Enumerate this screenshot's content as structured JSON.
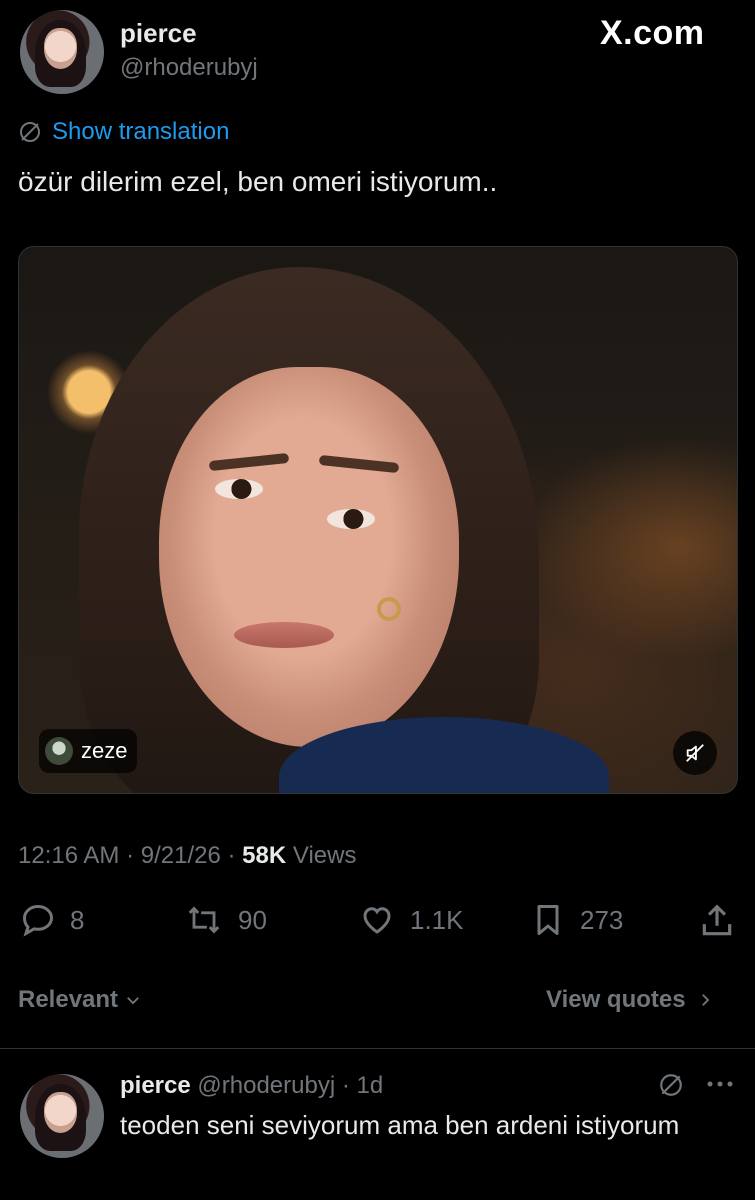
{
  "tweet": {
    "author": {
      "display_name": "pierce",
      "handle": "@rhoderubyj"
    },
    "site_logo": "X.com",
    "translate_label": "Show translation",
    "text": "özür dilerim ezel, ben omeri istiyorum..",
    "media": {
      "source_label": "zeze",
      "mute_icon": "speaker-muted-icon"
    },
    "meta": {
      "time": "12:16 AM",
      "date": "9/21/26",
      "views_count": "58K",
      "views_label": "Views",
      "separator": "·"
    },
    "actions": {
      "replies": "8",
      "reposts": "90",
      "likes": "1.1K",
      "bookmarks": "273"
    }
  },
  "filters": {
    "sort_label": "Relevant",
    "view_quotes_label": "View quotes"
  },
  "reply": {
    "display_name": "pierce",
    "handle": "@rhoderubyj",
    "time_ago": "1d",
    "separator": "·",
    "text": "teoden seni seviyorum ama ben ardeni istiyorum"
  },
  "colors": {
    "background": "#000000",
    "text": "#e7e9ea",
    "muted": "#71767b",
    "link": "#1d9bf0",
    "divider": "#2f3336"
  }
}
